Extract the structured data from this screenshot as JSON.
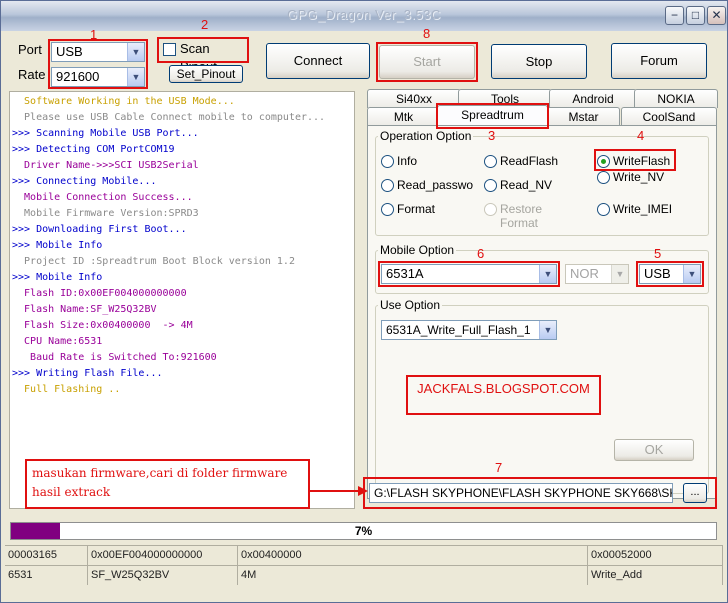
{
  "window": {
    "title": "GPG_Dragon  Ver_3.53C",
    "minimize": "−",
    "maximize": "□",
    "close": "✕"
  },
  "port": {
    "label": "Port",
    "value": "USB",
    "num": "1"
  },
  "rate": {
    "label": "Rate",
    "value": "921600"
  },
  "scan_pinout": {
    "label": "Scan Pinout",
    "num": "2"
  },
  "set_pinout": {
    "label": "Set_Pinout"
  },
  "buttons": {
    "connect": "Connect",
    "start": "Start",
    "stop": "Stop",
    "forum": "Forum",
    "start_num": "8"
  },
  "log": [
    {
      "text": "  Software Working in the USB Mode...",
      "color": "#c8a000"
    },
    {
      "text": "  Please use USB Cable Connect mobile to computer...",
      "color": "#8a8a8a"
    },
    {
      "text": ">>> Scanning Mobile USB Port...",
      "color": "#0000cc"
    },
    {
      "text": ">>> Detecting COM PortCOM19",
      "color": "#0000cc"
    },
    {
      "text": "  Driver Name->>>SCI USB2Serial",
      "color": "#990099"
    },
    {
      "text": ">>> Connecting Mobile...",
      "color": "#0000cc"
    },
    {
      "text": "  Mobile Connection Success...",
      "color": "#990099"
    },
    {
      "text": "  Mobile Firmware Version:SPRD3",
      "color": "#8a8a8a"
    },
    {
      "text": ">>> Downloading First Boot...",
      "color": "#0000cc"
    },
    {
      "text": ">>> Mobile Info",
      "color": "#0000cc"
    },
    {
      "text": "  Project ID :Spreadtrum Boot Block version 1.2",
      "color": "#8a8a8a"
    },
    {
      "text": ">>> Mobile Info",
      "color": "#0000cc"
    },
    {
      "text": "  Flash ID:0x00EF004000000000",
      "color": "#990099"
    },
    {
      "text": "  Flash Name:SF_W25Q32BV",
      "color": "#990099"
    },
    {
      "text": "  Flash Size:0x00400000  -> 4M",
      "color": "#990099"
    },
    {
      "text": "  CPU Name:6531",
      "color": "#990099"
    },
    {
      "text": "   Baud Rate is Switched To:921600",
      "color": "#990099"
    },
    {
      "text": ">>> Writing Flash File...",
      "color": "#0000cc"
    },
    {
      "text": "  Full Flashing ..",
      "color": "#c8a000"
    }
  ],
  "tabs_row1": [
    "Si40xx",
    "Tools",
    "Android",
    "NOKIA"
  ],
  "tabs_row2": [
    "Mtk",
    "Spreadtrum",
    "Mstar",
    "CoolSand"
  ],
  "operation": {
    "title": "Operation Option",
    "num": "3",
    "write_flash_num": "4",
    "options": [
      "Info",
      "ReadFlash",
      "WriteFlash",
      "Read_passwo",
      "Read_NV",
      "Write_NV",
      "Format",
      "Restore Format",
      "Write_IMEI"
    ],
    "selected": "WriteFlash"
  },
  "mobile": {
    "title": "Mobile Option",
    "model": "6531A",
    "model_num": "6",
    "flash_type": "NOR",
    "conn": "USB",
    "conn_num": "5"
  },
  "use_option": {
    "title": "Use Option",
    "value": "6531A_Write_Full_Flash_1"
  },
  "watermark": "JACKFALS.BLOGSPOT.COM",
  "ok_button": "OK",
  "firmware": {
    "path": "G:\\FLASH SKYPHONE\\FLASH SKYPHONE SKY668\\SK",
    "browse": "...",
    "num": "7"
  },
  "annotation": "masukan firmware,cari di folder firmware hasil extrack",
  "progress": {
    "percent": 7,
    "label": "7%"
  },
  "status_rows": [
    [
      "00003165",
      "0x00EF004000000000",
      "0x00400000",
      "",
      "0x00052000"
    ],
    [
      "6531",
      "SF_W25Q32BV",
      "4M",
      "",
      "Write_Add"
    ]
  ],
  "colors": {
    "accent_red": "#e01010",
    "progress": "#800080"
  }
}
